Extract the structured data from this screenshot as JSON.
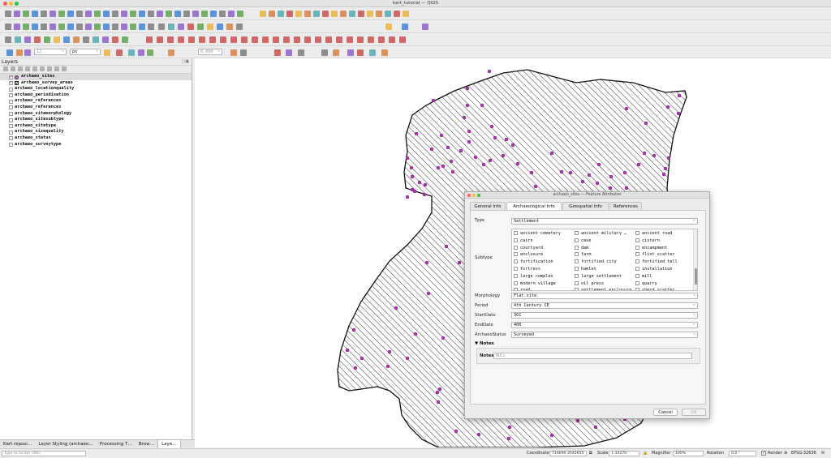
{
  "window": {
    "title": "kart_tutorial — QGIS"
  },
  "layers_panel": {
    "title": "Layers",
    "items": [
      {
        "label": "archaeo_sites",
        "checked": true,
        "icon": "point-layer-icon"
      },
      {
        "label": "archaeo_survey_areas",
        "checked": true,
        "icon": "polygon-layer-icon"
      },
      {
        "label": "archaeo_locationquality",
        "checked": false,
        "icon": "table-icon"
      },
      {
        "label": "archaeo_periodisation",
        "checked": false,
        "icon": "table-icon"
      },
      {
        "label": "archaeo_references",
        "checked": false,
        "icon": "table-icon"
      },
      {
        "label": "archaeo_references",
        "checked": false,
        "icon": "table-icon"
      },
      {
        "label": "archaeo_sitemorphology",
        "checked": false,
        "icon": "table-icon"
      },
      {
        "label": "archaeo_sitesubtype",
        "checked": false,
        "icon": "table-icon"
      },
      {
        "label": "archaeo_sitetype",
        "checked": false,
        "icon": "table-icon"
      },
      {
        "label": "archaeo_sizequality",
        "checked": false,
        "icon": "table-icon"
      },
      {
        "label": "archaeo_status",
        "checked": false,
        "icon": "table-icon"
      },
      {
        "label": "archaeo_surveytype",
        "checked": false,
        "icon": "table-icon"
      }
    ]
  },
  "bottom_tabs": [
    "Kart reposi…",
    "Layer Styling (archaeo…",
    "Processing T…",
    "Brow…",
    "Laye…"
  ],
  "toolbar": {
    "font_size": "12",
    "unit": "px",
    "value": "0,000"
  },
  "statusbar": {
    "locate_placeholder": "Type to locate (⌘K)",
    "coordinate_label": "Coordinate",
    "coordinate": "716690  3545655",
    "scale_label": "Scale",
    "scale": "1:34270",
    "magnifier_label": "Magnifier",
    "magnifier": "100%",
    "rotation_label": "Rotation",
    "rotation": "0,0 °",
    "render_label": "Render",
    "crs": "EPSG:32636"
  },
  "dialog": {
    "title": "archaeo_sites — Feature Attributes",
    "tabs": [
      "General Info",
      "Archaeological Info",
      "Geospatial Info",
      "References"
    ],
    "active_tab": 1,
    "fields": {
      "type_label": "Type",
      "type_value": "Settlement",
      "subtype_label": "Subtype",
      "morphology_label": "Morphology",
      "morphology_value": "Flat site",
      "period_label": "Period",
      "period_value": "4th Century CE",
      "startdate_label": "StartDate",
      "startdate_value": "301",
      "enddate_label": "EndDate",
      "enddate_value": "400",
      "status_label": "ArchaeoStatus",
      "status_value": "Surveyed"
    },
    "subtypes": [
      [
        "ancient cemetery",
        "ancient military …",
        "ancient road"
      ],
      [
        "cairn",
        "cave",
        "cistern"
      ],
      [
        "courtyard",
        "dam",
        "encampment"
      ],
      [
        "enclosure",
        "farm",
        "flint scatter"
      ],
      [
        "fortification",
        "fortified city",
        "fortified tell"
      ],
      [
        "fortress",
        "hamlet",
        "installation"
      ],
      [
        "large complex",
        "large settlement",
        "mill"
      ],
      [
        "modern village",
        "oil press",
        "quarry"
      ],
      [
        "road",
        "settlement enclosure",
        "sherd scatter"
      ]
    ],
    "notes_section": "Notes",
    "notes_label": "Notes",
    "notes_placeholder": "NULL",
    "cancel_label": "Cancel",
    "ok_label": "OK"
  },
  "colors": {
    "point": "#b832b8",
    "hatch": "#222222",
    "accent": "#3d7be0"
  }
}
